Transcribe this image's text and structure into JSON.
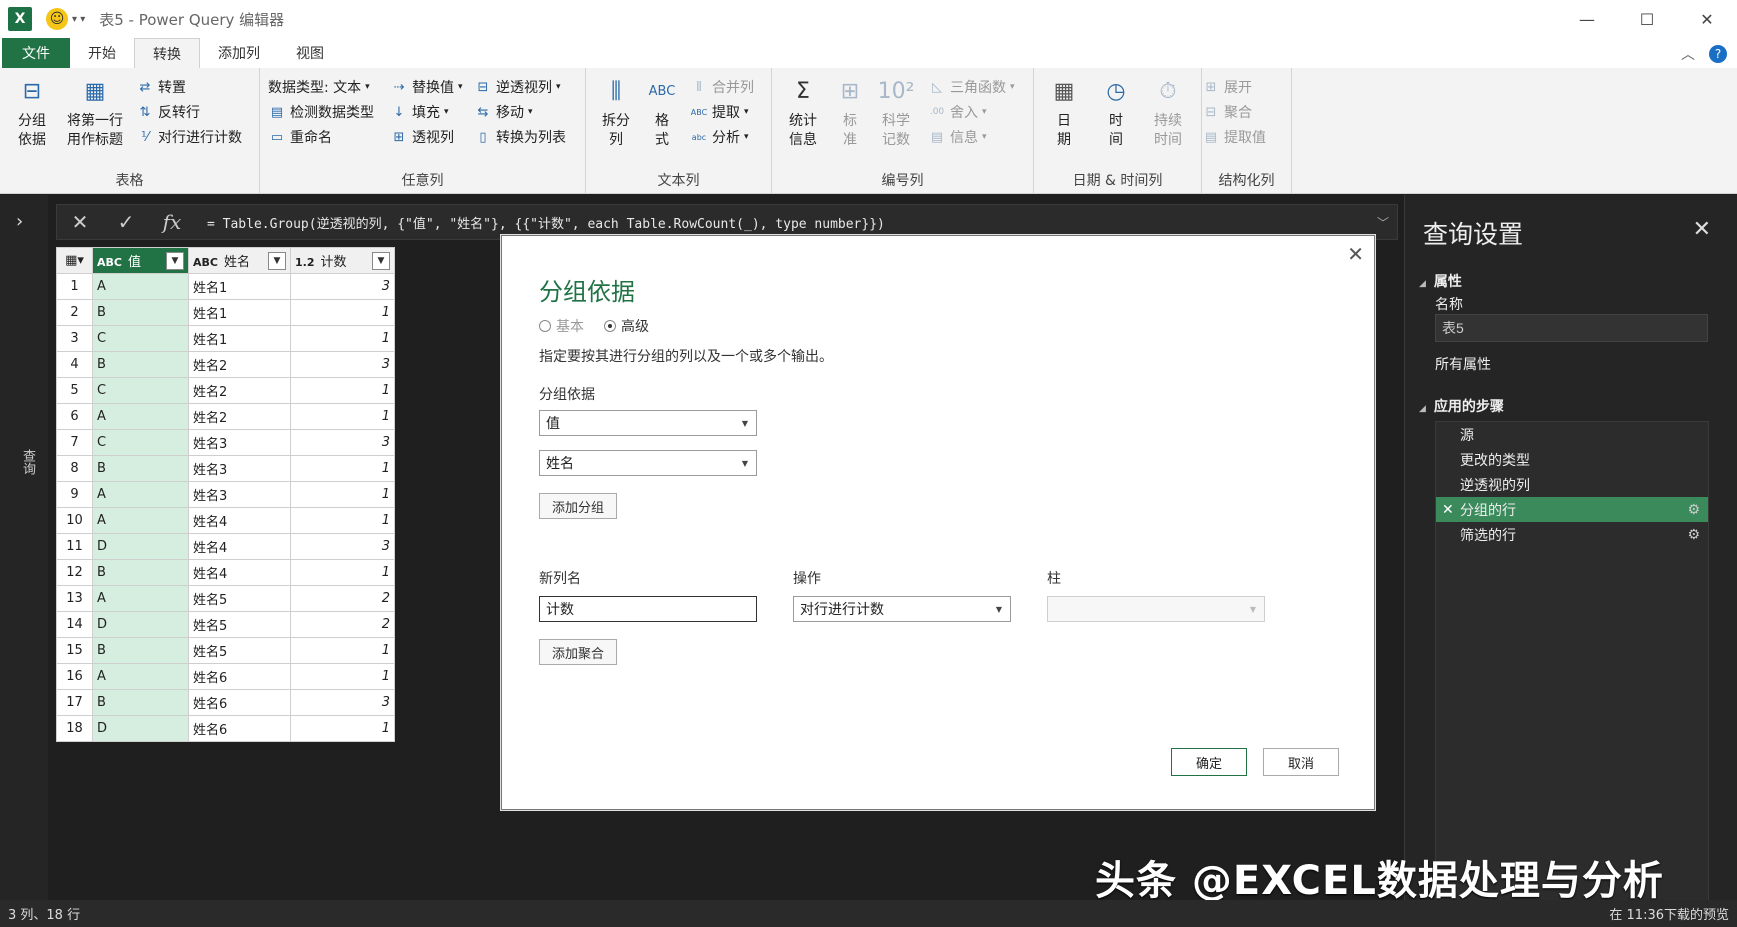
{
  "titlebar": {
    "title": "表5 - Power Query 编辑器",
    "excel_icon_label": "X",
    "smiley": "☺"
  },
  "tabs": [
    "文件",
    "开始",
    "转换",
    "添加列",
    "视图"
  ],
  "ribbon": {
    "table_group": {
      "label": "表格",
      "group_by": "分组\n依据",
      "use_first_row": "将第一行\n用作标题",
      "transpose": "转置",
      "reverse_rows": "反转行",
      "count_rows": "对行进行计数"
    },
    "any_column_group": {
      "label": "任意列",
      "data_type": "数据类型: 文本",
      "detect_type": "检测数据类型",
      "rename": "重命名",
      "replace_values": "替换值",
      "fill": "填充",
      "pivot": "透视列",
      "unpivot": "逆透视列",
      "move": "移动",
      "to_list": "转换为列表"
    },
    "text_column_group": {
      "label": "文本列",
      "split": "拆分\n列",
      "format": "格\n式",
      "merge": "合并列",
      "extract": "提取",
      "parse": "分析"
    },
    "number_column_group": {
      "label": "编号列",
      "statistics": "统计\n信息",
      "standard": "标\n准",
      "scientific": "科学\n记数",
      "trig": "三角函数",
      "rounding": "舍入",
      "information": "信息"
    },
    "datetime_group": {
      "label": "日期 & 时间列",
      "date": "日\n期",
      "time": "时\n间",
      "duration": "持续\n时间"
    },
    "structured_group": {
      "label": "结构化列",
      "expand": "展开",
      "aggregate": "聚合",
      "extract_values": "提取值"
    }
  },
  "leftpane": {
    "label": "查询"
  },
  "formula": {
    "text": "= Table.Group(逆透视的列, {\"值\", \"姓名\"}, {{\"计数\", each Table.RowCount(_), type number}})"
  },
  "grid": {
    "headers": [
      {
        "type": "ABC",
        "name": "值"
      },
      {
        "type": "ABC",
        "name": "姓名"
      },
      {
        "type": "1.2",
        "name": "计数"
      }
    ],
    "rows": [
      [
        "1",
        "A",
        "姓名1",
        "3"
      ],
      [
        "2",
        "B",
        "姓名1",
        "1"
      ],
      [
        "3",
        "C",
        "姓名1",
        "1"
      ],
      [
        "4",
        "B",
        "姓名2",
        "3"
      ],
      [
        "5",
        "C",
        "姓名2",
        "1"
      ],
      [
        "6",
        "A",
        "姓名2",
        "1"
      ],
      [
        "7",
        "C",
        "姓名3",
        "3"
      ],
      [
        "8",
        "B",
        "姓名3",
        "1"
      ],
      [
        "9",
        "A",
        "姓名3",
        "1"
      ],
      [
        "10",
        "A",
        "姓名4",
        "1"
      ],
      [
        "11",
        "D",
        "姓名4",
        "3"
      ],
      [
        "12",
        "B",
        "姓名4",
        "1"
      ],
      [
        "13",
        "A",
        "姓名5",
        "2"
      ],
      [
        "14",
        "D",
        "姓名5",
        "2"
      ],
      [
        "15",
        "B",
        "姓名5",
        "1"
      ],
      [
        "16",
        "A",
        "姓名6",
        "1"
      ],
      [
        "17",
        "B",
        "姓名6",
        "3"
      ],
      [
        "18",
        "D",
        "姓名6",
        "1"
      ]
    ]
  },
  "dialog": {
    "title": "分组依据",
    "radio_basic": "基本",
    "radio_advanced": "高级",
    "description": "指定要按其进行分组的列以及一个或多个输出。",
    "group_by_label": "分组依据",
    "group_by_1": "值",
    "group_by_2": "姓名",
    "add_group": "添加分组",
    "new_col_label": "新列名",
    "operation_label": "操作",
    "column_label": "柱",
    "new_col_value": "计数",
    "operation_value": "对行进行计数",
    "column_value": "",
    "add_aggregation": "添加聚合",
    "ok": "确定",
    "cancel": "取消"
  },
  "query_settings": {
    "title": "查询设置",
    "properties": "属性",
    "name_label": "名称",
    "name_value": "表5",
    "all_properties": "所有属性",
    "applied_steps": "应用的步骤",
    "steps": [
      "源",
      "更改的类型",
      "逆透视的列",
      "分组的行",
      "筛选的行"
    ],
    "active_step_index": 3
  },
  "status": {
    "left": "3 列、18 行",
    "right": "在 11:36下载的预览"
  },
  "watermark": "头条 @EXCEL数据处理与分析",
  "colors": {
    "excel_green": "#217346",
    "active_step": "#3a8a5c",
    "selected_col": "#d6eedf"
  }
}
